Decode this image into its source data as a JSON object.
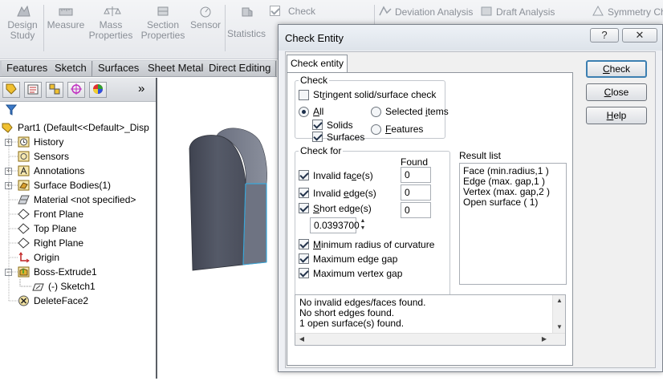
{
  "ribbon": {
    "design_study": "Design Study",
    "measure": "Measure",
    "mass_properties": "Mass Properties",
    "section_properties": "Section Properties",
    "sensor": "Sensor",
    "statistics": "Statistics",
    "check": "Check",
    "deviation_analysis": "Deviation Analysis",
    "draft_analysis": "Draft Analysis",
    "symmetry_check": "Symmetry Ch"
  },
  "tabs": [
    "Features",
    "Sketch",
    "Surfaces",
    "Sheet Metal",
    "Direct Editing"
  ],
  "tree": {
    "more_glyph": "»",
    "items": [
      {
        "label": "Part1  (Default<<Default>_Disp"
      },
      {
        "label": "History"
      },
      {
        "label": "Sensors"
      },
      {
        "label": "Annotations"
      },
      {
        "label": "Surface Bodies(1)"
      },
      {
        "label": "Material <not specified>"
      },
      {
        "label": "Front Plane"
      },
      {
        "label": "Top Plane"
      },
      {
        "label": "Right Plane"
      },
      {
        "label": "Origin"
      },
      {
        "label": "Boss-Extrude1"
      },
      {
        "label": "(-) Sketch1"
      },
      {
        "label": "DeleteFace2"
      }
    ]
  },
  "dialog": {
    "title": "Check Entity",
    "help_glyph": "?",
    "close_glyph": "✕",
    "tab_label": "Check entity",
    "check_group": {
      "legend": "Check",
      "stringent": {
        "pre": "St",
        "u": "r",
        "post": "ingent solid/surface check",
        "checked": false
      },
      "all": {
        "u": "A",
        "post": "ll",
        "selected": true
      },
      "selected_items": {
        "pre": "Selected ",
        "u": "i",
        "post": "tems",
        "selected": false
      },
      "solids": {
        "label": "Solids",
        "checked": true
      },
      "surfaces": {
        "label": "Surfaces",
        "checked": true
      },
      "features": {
        "u": "F",
        "post": "eatures",
        "selected": false
      }
    },
    "check_for": {
      "legend": "Check for",
      "found_header": "Found",
      "invalid_faces": {
        "pre": "Invalid fa",
        "u": "c",
        "post": "e(s)",
        "checked": true,
        "found": "0"
      },
      "invalid_edges": {
        "pre": "Invalid ",
        "u": "e",
        "post": "dge(s)",
        "checked": true,
        "found": "0"
      },
      "short_edges": {
        "u": "S",
        "post": "hort edge(s)",
        "checked": true,
        "found": "0"
      },
      "short_value": "0.0393700",
      "min_radius": {
        "u": "M",
        "post": "inimum radius of curvature",
        "checked": true
      },
      "max_edge_gap": {
        "label": "Maximum edge gap",
        "checked": true
      },
      "max_vertex_gap": {
        "label": "Maximum vertex gap",
        "checked": true
      }
    },
    "result_list": {
      "header": "Result list",
      "items": [
        "Face (min.radius,1  )",
        "Edge (max. gap,1  )",
        "Vertex (max. gap,2  )",
        "Open surface ( 1)"
      ]
    },
    "messages": [
      "No invalid edges/faces found.",
      "No short edges found.",
      "1 open surface(s) found."
    ],
    "buttons": {
      "check": {
        "u": "C",
        "post": "heck"
      },
      "close": {
        "u": "C",
        "post": "lose"
      },
      "help": {
        "u": "H",
        "post": "elp"
      }
    }
  },
  "colors": {
    "accent_blue": "#3c7fb1",
    "part_body": "#4b4f5c",
    "edge_highlight": "#3aa6d8"
  }
}
